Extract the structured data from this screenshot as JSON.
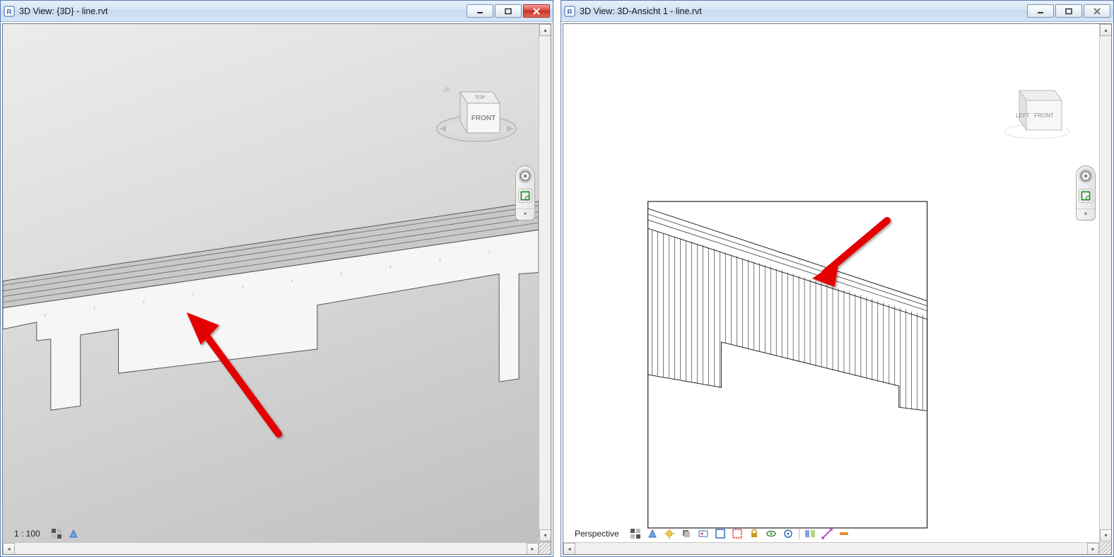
{
  "windows": [
    {
      "title": "3D View: {3D} - line.rvt",
      "scale_label": "1 : 100",
      "cube": {
        "face1": "TOP",
        "face2": "FRONT"
      }
    },
    {
      "title": "3D View: 3D-Ansicht 1 - line.rvt",
      "scale_label": "Perspective",
      "cube": {
        "face1": "LEFT",
        "face2": "FRONT"
      }
    }
  ],
  "icons": {
    "minimize": "minimize",
    "maximize": "maximize",
    "close": "close"
  }
}
